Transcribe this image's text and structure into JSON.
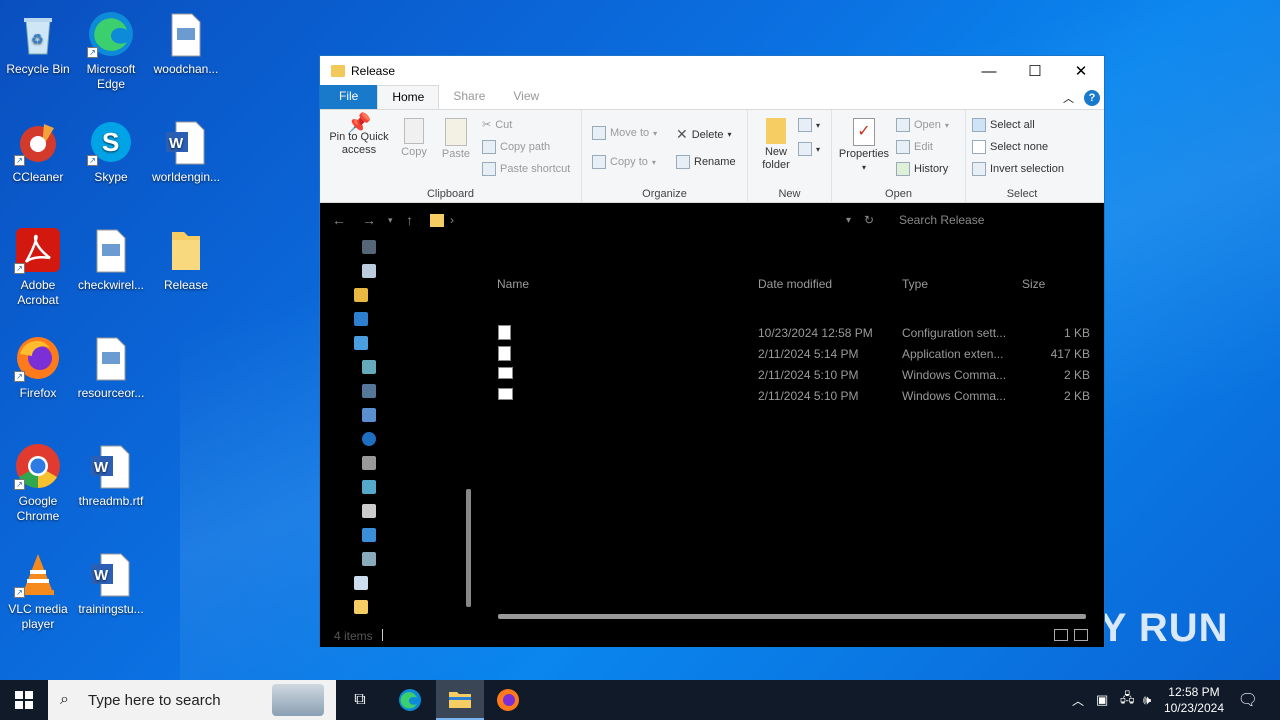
{
  "desktop": {
    "icons": [
      {
        "label": "Recycle Bin",
        "icon": "recycle-bin-icon"
      },
      {
        "label": "Microsoft Edge",
        "icon": "edge-icon"
      },
      {
        "label": "woodchan...",
        "icon": "image-file-icon"
      },
      {
        "label": "CCleaner",
        "icon": "ccleaner-icon"
      },
      {
        "label": "Skype",
        "icon": "skype-icon"
      },
      {
        "label": "worldengin...",
        "icon": "word-doc-icon"
      },
      {
        "label": "Adobe Acrobat",
        "icon": "acrobat-icon"
      },
      {
        "label": "checkwirel...",
        "icon": "image-file-icon"
      },
      {
        "label": "Release",
        "icon": "folder-icon"
      },
      {
        "label": "Firefox",
        "icon": "firefox-icon"
      },
      {
        "label": "resourceor...",
        "icon": "image-file-icon"
      },
      {
        "label": "Google Chrome",
        "icon": "chrome-icon"
      },
      {
        "label": "threadmb.rtf",
        "icon": "word-doc-icon"
      },
      {
        "label": "VLC media player",
        "icon": "vlc-icon"
      },
      {
        "label": "trainingstu...",
        "icon": "word-doc-icon"
      }
    ]
  },
  "window": {
    "title": "Release",
    "tabs": {
      "file": "File",
      "home": "Home",
      "share": "Share",
      "view": "View"
    },
    "ribbon": {
      "clipboard": {
        "pin": "Pin to Quick access",
        "copy": "Copy",
        "paste": "Paste",
        "cut": "Cut",
        "copy_path": "Copy path",
        "paste_shortcut": "Paste shortcut",
        "label": "Clipboard"
      },
      "organize": {
        "move_to": "Move to",
        "copy_to": "Copy to",
        "delete": "Delete",
        "rename": "Rename",
        "label": "Organize"
      },
      "new": {
        "new_folder": "New folder",
        "label": "New"
      },
      "open": {
        "properties": "Properties",
        "open": "Open",
        "edit": "Edit",
        "history": "History",
        "label": "Open"
      },
      "select": {
        "select_all": "Select all",
        "select_none": "Select none",
        "invert": "Invert selection",
        "label": "Select"
      }
    },
    "search_placeholder": "Search Release",
    "columns": {
      "name": "Name",
      "date": "Date modified",
      "type": "Type",
      "size": "Size"
    },
    "files": [
      {
        "date": "10/23/2024 12:58 PM",
        "type": "Configuration sett...",
        "size": "1 KB"
      },
      {
        "date": "2/11/2024 5:14 PM",
        "type": "Application exten...",
        "size": "417 KB"
      },
      {
        "date": "2/11/2024 5:10 PM",
        "type": "Windows Comma...",
        "size": "2 KB"
      },
      {
        "date": "2/11/2024 5:10 PM",
        "type": "Windows Comma...",
        "size": "2 KB"
      }
    ],
    "status": "4 items"
  },
  "taskbar": {
    "search_placeholder": "Type here to search",
    "time": "12:58 PM",
    "date": "10/23/2024"
  },
  "watermark": "ANY RUN"
}
